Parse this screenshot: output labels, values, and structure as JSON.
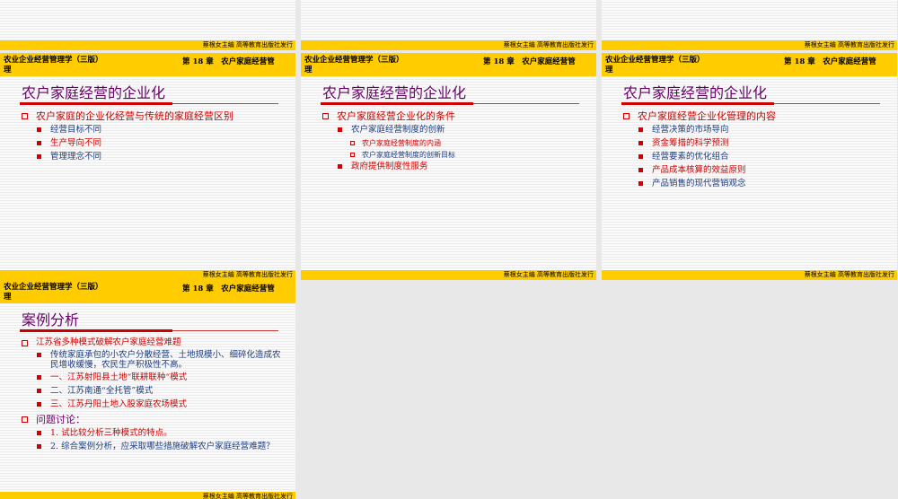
{
  "footer_text": "蔡根女主编 高等教育出版社发行",
  "header": {
    "book": "农业企业经营管理学（三版）",
    "book_cont": "理",
    "chapter": "第 18 章　农户家庭经营管"
  },
  "slide1": {
    "title": "农户家庭经营的企业化",
    "point": "农户家庭的企业化经营与传统的家庭经营区别",
    "subs": [
      "经营目标不同",
      "生产导向不同",
      "管理理念不同"
    ]
  },
  "slide2": {
    "title": "农户家庭经营的企业化",
    "point": "农户家庭经营企业化的条件",
    "sub1": "农户家庭经营制度的创新",
    "subsub": [
      "农户家庭经营制度的内涵",
      "农户家庭经营制度的创新目标"
    ],
    "sub2": "政府提供制度性服务"
  },
  "slide3": {
    "title": "农户家庭经营的企业化",
    "point": "农户家庭经营企业化管理的内容",
    "subs": [
      "经营决策的市场导向",
      "资金筹措的科学预测",
      "经营要素的优化组合",
      "产品成本核算的效益原则",
      "产品销售的现代营销观念"
    ]
  },
  "slide4": {
    "title": "案例分析",
    "point1": "江苏省多种模式破解农户家庭经营难题",
    "subs1": [
      "传统家庭承包的小农户分散经营、土地规模小、细碎化造成农民增收缓慢，农民生产积极性不高。",
      "一、江苏射阳县土地“联耕联种“模式",
      "二、江苏南通“全托管”模式",
      "三、江苏丹阳土地入股家庭农场模式"
    ],
    "point2": "问题讨论：",
    "subs2": [
      "1. 试比较分析三种模式的特点。",
      "2. 综合案例分析，应采取哪些措施破解农户家庭经营难题？"
    ]
  },
  "colors": {
    "header_bg": "#ffcc00",
    "title": "#660066",
    "accent_red": "#cc0000",
    "text_blue": "#1c3c80",
    "desktop": "#e8e8e8"
  }
}
